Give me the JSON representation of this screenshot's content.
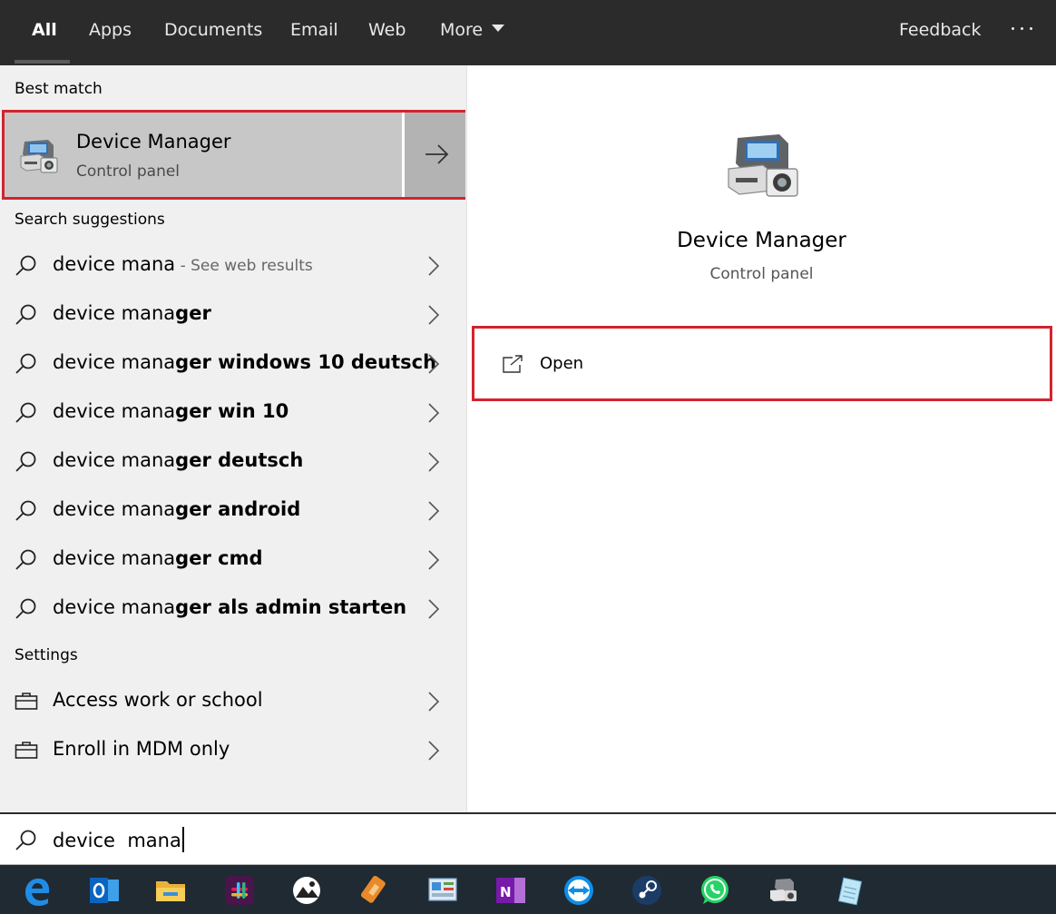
{
  "tabs": [
    {
      "label": "All",
      "active": true
    },
    {
      "label": "Apps"
    },
    {
      "label": "Documents"
    },
    {
      "label": "Email"
    },
    {
      "label": "Web"
    },
    {
      "label": "More"
    }
  ],
  "feedback_label": "Feedback",
  "best_match": {
    "heading": "Best match",
    "title_regular": "Device Mana",
    "title_rest": "ger",
    "subtitle": "Control panel"
  },
  "suggestions": {
    "heading": "Search suggestions",
    "items": [
      {
        "prefix": "device mana",
        "bold": "",
        "hint": " - See web results"
      },
      {
        "prefix": "device mana",
        "bold": "ger",
        "hint": ""
      },
      {
        "prefix": "device mana",
        "bold": "ger windows 10 deutsch",
        "hint": ""
      },
      {
        "prefix": "device mana",
        "bold": "ger win 10",
        "hint": ""
      },
      {
        "prefix": "device mana",
        "bold": "ger deutsch",
        "hint": ""
      },
      {
        "prefix": "device mana",
        "bold": "ger android",
        "hint": ""
      },
      {
        "prefix": "device mana",
        "bold": "ger cmd",
        "hint": ""
      },
      {
        "prefix": "device mana",
        "bold": "ger als admin starten",
        "hint": ""
      }
    ]
  },
  "settings": {
    "heading": "Settings",
    "items": [
      {
        "label": "Access work or school"
      },
      {
        "label": "Enroll in MDM only"
      }
    ]
  },
  "preview": {
    "title": "Device Manager",
    "subtitle": "Control panel",
    "open_label": "Open"
  },
  "search": {
    "value": "device  mana"
  },
  "taskbar_icons": [
    "edge-icon",
    "outlook-icon",
    "file-explorer-icon",
    "slack-icon",
    "camera-app-icon",
    "battery-app-icon",
    "control-panel-icon",
    "onenote-icon",
    "teamviewer-icon",
    "steam-icon",
    "whatsapp-icon",
    "device-manager-taskbar-icon",
    "notepad-icon"
  ],
  "colors": {
    "highlight_border": "#d2242f",
    "topbar": "#2b2b2b",
    "taskbar": "#1f2a33"
  }
}
